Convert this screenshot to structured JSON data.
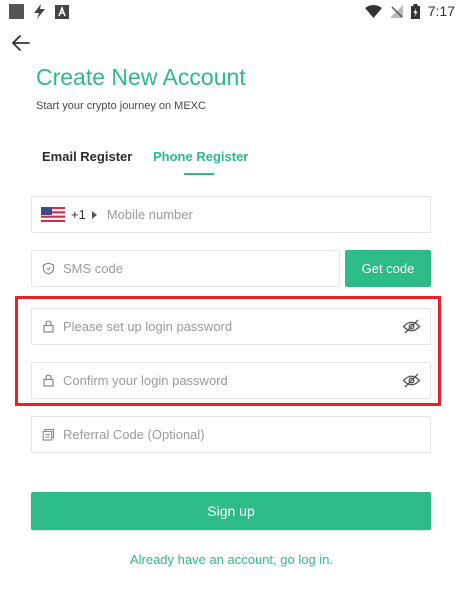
{
  "status_bar": {
    "time": "7:17"
  },
  "header": {
    "title": "Create New Account",
    "subtitle": "Start your crypto journey on MEXC"
  },
  "tabs": [
    {
      "label": "Email Register",
      "active": false
    },
    {
      "label": "Phone Register",
      "active": true
    }
  ],
  "form": {
    "country_code": "+1",
    "mobile_placeholder": "Mobile number",
    "sms_placeholder": "SMS code",
    "get_code_label": "Get code",
    "password_placeholder": "Please set up login password",
    "confirm_placeholder": "Confirm your login password",
    "referral_placeholder": "Referral Code (Optional)",
    "signup_label": "Sign up",
    "login_link": "Already have an account, go log in."
  },
  "colors": {
    "accent": "#2dbb87",
    "highlight": "#e8202a"
  },
  "icons": [
    "back-arrow-icon",
    "us-flag-icon",
    "shield-icon",
    "lock-icon",
    "eye-off-icon",
    "referral-icon"
  ]
}
